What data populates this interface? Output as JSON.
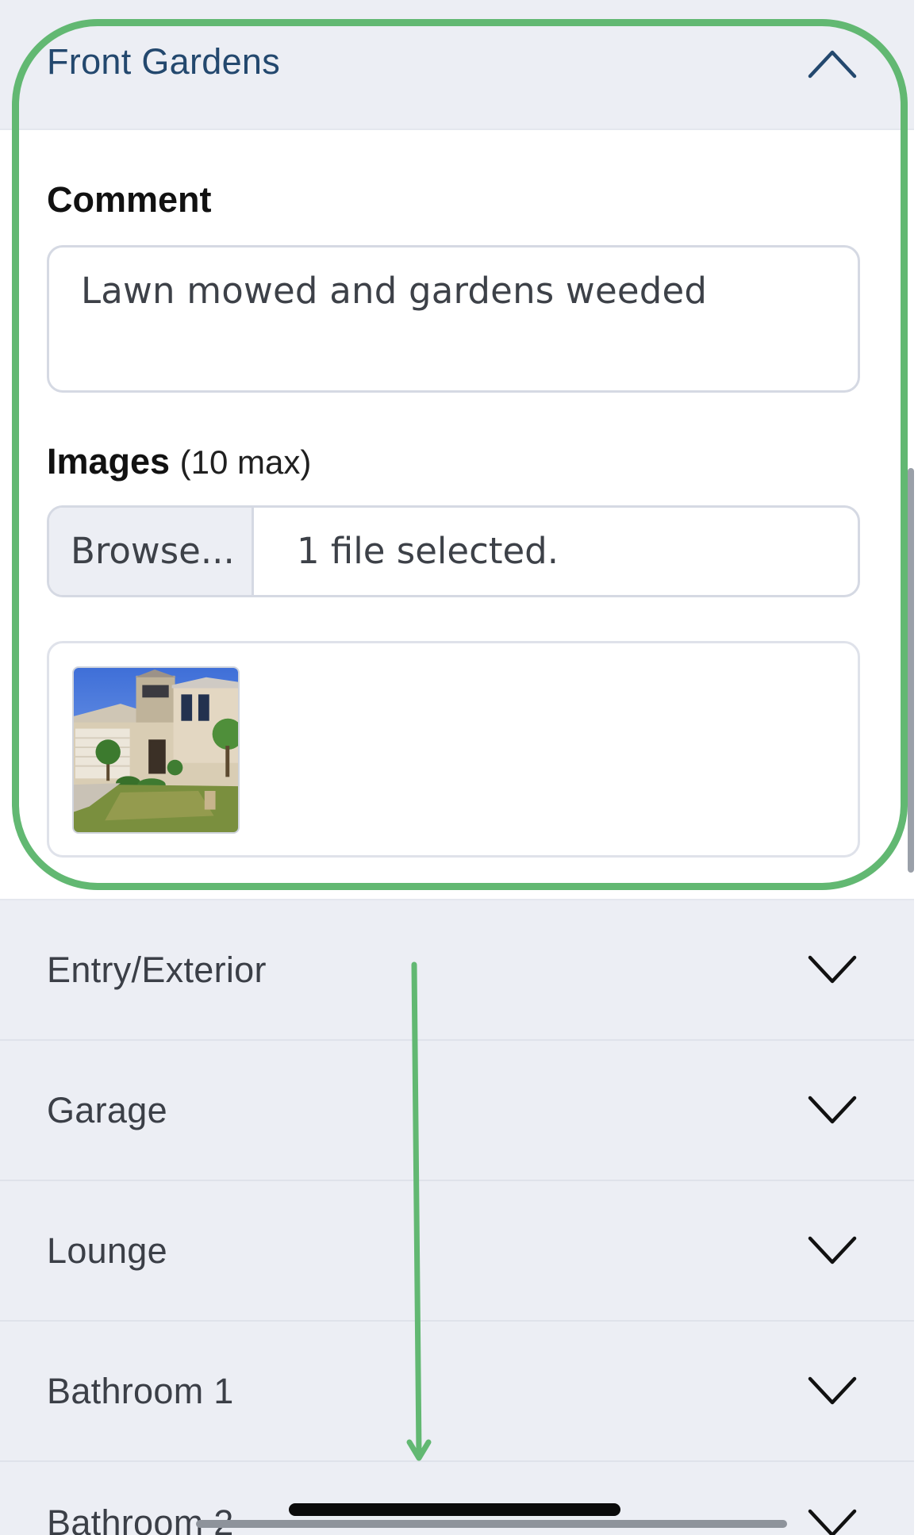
{
  "accordion": {
    "open_section": {
      "title": "Front Gardens",
      "comment_label": "Comment",
      "comment_value": "Lawn mowed and gardens weeded",
      "images_label": "Images",
      "images_note": "(10 max)",
      "browse_label": "Browse...",
      "file_status": "1 file selected.",
      "thumbnail_icon": "house-photo"
    },
    "sections": [
      {
        "title": "Entry/Exterior"
      },
      {
        "title": "Garage"
      },
      {
        "title": "Lounge"
      },
      {
        "title": "Bathroom 1"
      },
      {
        "title": "Bathroom 2"
      }
    ]
  },
  "icons": {
    "expanded": "chevron-up-icon",
    "collapsed": "chevron-down-icon"
  },
  "colors": {
    "header_bg": "#eceef4",
    "open_title": "#23486e",
    "annotation_green": "#62b872"
  }
}
